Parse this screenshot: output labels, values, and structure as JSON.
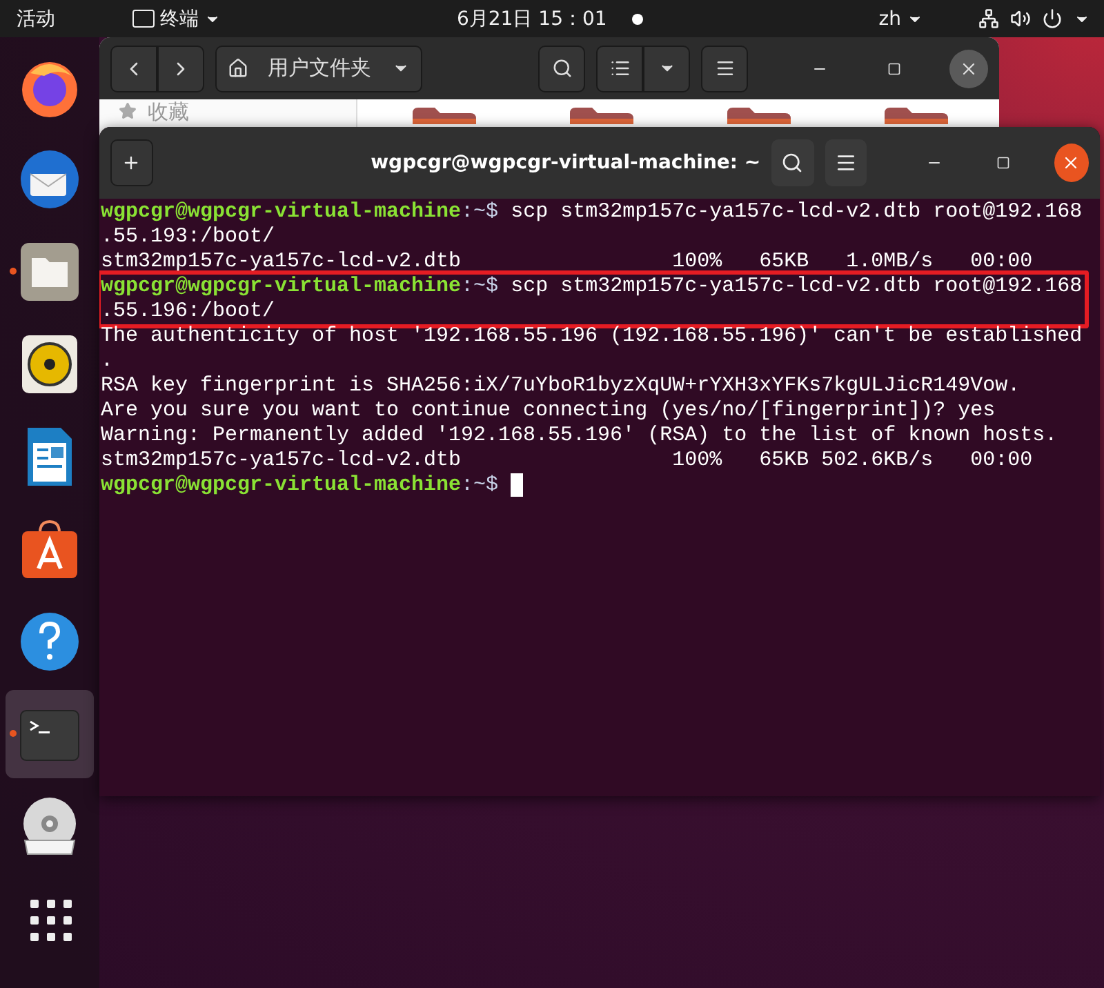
{
  "top_bar": {
    "activities": "活动",
    "app_menu": "终端",
    "clock": "6月21日  15：01",
    "keyboard_layout": "zh"
  },
  "dock": {
    "items": [
      {
        "kind": "firefox",
        "running": false,
        "selected": false
      },
      {
        "kind": "mail",
        "running": false,
        "selected": false
      },
      {
        "kind": "files",
        "running": true,
        "selected": false
      },
      {
        "kind": "music",
        "running": false,
        "selected": false
      },
      {
        "kind": "writer",
        "running": false,
        "selected": false
      },
      {
        "kind": "store",
        "running": false,
        "selected": false
      },
      {
        "kind": "help",
        "running": false,
        "selected": false
      },
      {
        "kind": "terminal",
        "running": true,
        "selected": true
      },
      {
        "kind": "dvd",
        "running": false,
        "selected": false
      },
      {
        "kind": "apps",
        "running": false,
        "selected": false
      }
    ]
  },
  "file_manager": {
    "location": "用户文件夹",
    "sidebar_heading": "收藏"
  },
  "terminal": {
    "title": "wgpcgr@wgpcgr-virtual-machine: ~",
    "lines": [
      {
        "kind": "prompt",
        "user_host": "wgpcgr@wgpcgr-virtual-machine",
        "path": ":~$",
        "command": "scp stm32mp157c-ya157c-lcd-v2.dtb root@192.168",
        "highlighted": false,
        "cursor": false
      },
      {
        "kind": "output",
        "text": ".55.193:/boot/",
        "highlighted": false
      },
      {
        "kind": "output",
        "text": "stm32mp157c-ya157c-lcd-v2.dtb                 100%   65KB   1.0MB/s   00:00",
        "highlighted": false
      },
      {
        "kind": "prompt",
        "user_host": "wgpcgr@wgpcgr-virtual-machine",
        "path": ":~$",
        "command": "scp stm32mp157c-ya157c-lcd-v2.dtb root@192.168",
        "highlighted": true,
        "cursor": false
      },
      {
        "kind": "output",
        "text": ".55.196:/boot/",
        "highlighted": true
      },
      {
        "kind": "output",
        "text": "The authenticity of host '192.168.55.196 (192.168.55.196)' can't be established",
        "highlighted": false
      },
      {
        "kind": "output",
        "text": ".",
        "highlighted": false
      },
      {
        "kind": "output",
        "text": "RSA key fingerprint is SHA256:iX/7uYboR1byzXqUW+rYXH3xYFKs7kgULJicR149Vow.",
        "highlighted": false
      },
      {
        "kind": "output",
        "text": "Are you sure you want to continue connecting (yes/no/[fingerprint])? yes",
        "highlighted": false
      },
      {
        "kind": "output",
        "text": "Warning: Permanently added '192.168.55.196' (RSA) to the list of known hosts.",
        "highlighted": false
      },
      {
        "kind": "output",
        "text": "stm32mp157c-ya157c-lcd-v2.dtb                 100%   65KB 502.6KB/s   00:00",
        "highlighted": false
      },
      {
        "kind": "prompt",
        "user_host": "wgpcgr@wgpcgr-virtual-machine",
        "path": ":~$",
        "highlighted": false,
        "cursor": true
      }
    ]
  }
}
